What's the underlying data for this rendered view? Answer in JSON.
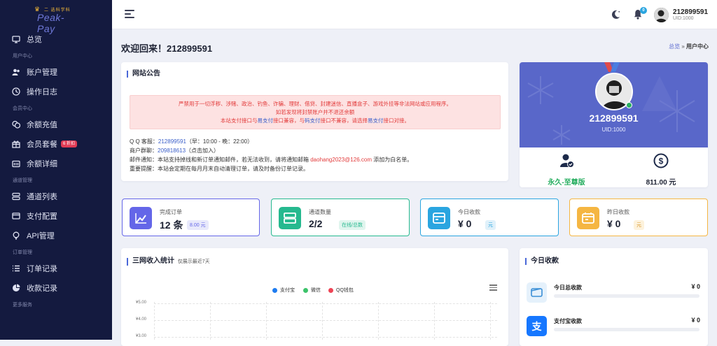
{
  "logo": {
    "top_text": "二 选科学科",
    "main_text": "Peak-Pay"
  },
  "sidebar": {
    "items": [
      {
        "type": "item",
        "label": "总览",
        "icon": "monitor-icon"
      },
      {
        "type": "section",
        "label": "用户中心"
      },
      {
        "type": "item",
        "label": "账户管理",
        "icon": "users-icon"
      },
      {
        "type": "item",
        "label": "操作日志",
        "icon": "history-icon"
      },
      {
        "type": "section",
        "label": "会员中心"
      },
      {
        "type": "item",
        "label": "余额充值",
        "icon": "coins-icon"
      },
      {
        "type": "item",
        "label": "会员套餐",
        "icon": "gift-icon",
        "badge": "6 折扣"
      },
      {
        "type": "item",
        "label": "余额详细",
        "icon": "wallet-icon"
      },
      {
        "type": "section",
        "label": "通道管理"
      },
      {
        "type": "item",
        "label": "通道列表",
        "icon": "server-icon"
      },
      {
        "type": "item",
        "label": "支付配置",
        "icon": "payment-config-icon"
      },
      {
        "type": "item",
        "label": "API管理",
        "icon": "bulb-icon"
      },
      {
        "type": "section",
        "label": "订单管理"
      },
      {
        "type": "item",
        "label": "订单记录",
        "icon": "list-icon"
      },
      {
        "type": "item",
        "label": "收款记录",
        "icon": "pie-icon"
      },
      {
        "type": "section",
        "label": "更多服务"
      }
    ]
  },
  "topbar": {
    "username": "212899591",
    "uid": "UID:1000",
    "notification_count": "0"
  },
  "page": {
    "title": "欢迎回来！212899591",
    "breadcrumb_home": "总览",
    "breadcrumb_sep": "»",
    "breadcrumb_current": "用户中心"
  },
  "announcement": {
    "title": "网站公告",
    "alert_line1": "严禁用于一切浮秽、涉赌、政治、钓鱼、诈骗、理财、借贷、封建迷信、直播盒子、游戏外挂等非法网站或应用程序。",
    "alert_line2": "如若发现将封禁账户并不退还余额",
    "alert_line3_a": "本站支付接口与",
    "alert_line3_b": "易支付",
    "alert_line3_c": "接口兼容，与",
    "alert_line3_d": "码支付",
    "alert_line3_e": "接口不兼容，请选择",
    "alert_line3_f": "易支付",
    "alert_line3_g": "接口对接。",
    "qq_label": "Q Q 客服：",
    "qq_number": "212899591",
    "qq_hours": "（早：10:00 - 晚：22:00）",
    "group_label": "商户群聊：",
    "group_number": "209818613",
    "group_note": "（点击加入）",
    "mail_text": "邮件通知：本站支持掉线和新订单通知邮件，若无法收到，请将通知邮箱",
    "mail_address": "daohang2023@126.com",
    "mail_tail": "添加为白名单。",
    "reminder": "重要提醒：本站会定期在每月月末自动清理订单，请及时备份订单记录。"
  },
  "profile": {
    "name": "212899591",
    "uid": "UID:1000",
    "membership": "永久-至尊版",
    "membership_color": "#27ae60",
    "balance": "811.00 元"
  },
  "stats": [
    {
      "label": "完成订单",
      "value": "12 条",
      "pill": "8.00 元",
      "color": "#6466e8",
      "icon": "trend-icon"
    },
    {
      "label": "通道数量",
      "value": "2/2",
      "pill": "在线/总数",
      "color": "#26b98f",
      "icon": "channel-icon"
    },
    {
      "label": "今日收款",
      "value": "¥ 0",
      "pill": "元",
      "color": "#2aa5e0",
      "icon": "card-icon"
    },
    {
      "label": "昨日收款",
      "value": "¥ 0",
      "pill": "元",
      "color": "#f5b642",
      "icon": "calendar-icon"
    }
  ],
  "chart_card": {
    "title": "三网收入统计",
    "subtitle": "仅展示最近7天"
  },
  "chart_data": {
    "type": "line",
    "legend": [
      {
        "name": "支付宝",
        "color": "#1e7cf0"
      },
      {
        "name": "微信",
        "color": "#3cc36a"
      },
      {
        "name": "QQ钱包",
        "color": "#ee4455"
      }
    ],
    "y_ticks": [
      "¥5.00",
      "¥4.00",
      "¥3.00"
    ],
    "ylim": [
      0,
      5
    ],
    "grid": true
  },
  "income": {
    "title": "今日收款",
    "rows": [
      {
        "label": "今日总收款",
        "value": "¥ 0",
        "icon": "wallet-outline-icon",
        "fraction": 0
      },
      {
        "label": "支付宝收款",
        "value": "¥ 0",
        "icon": "alipay-icon",
        "fraction": 0
      }
    ]
  }
}
